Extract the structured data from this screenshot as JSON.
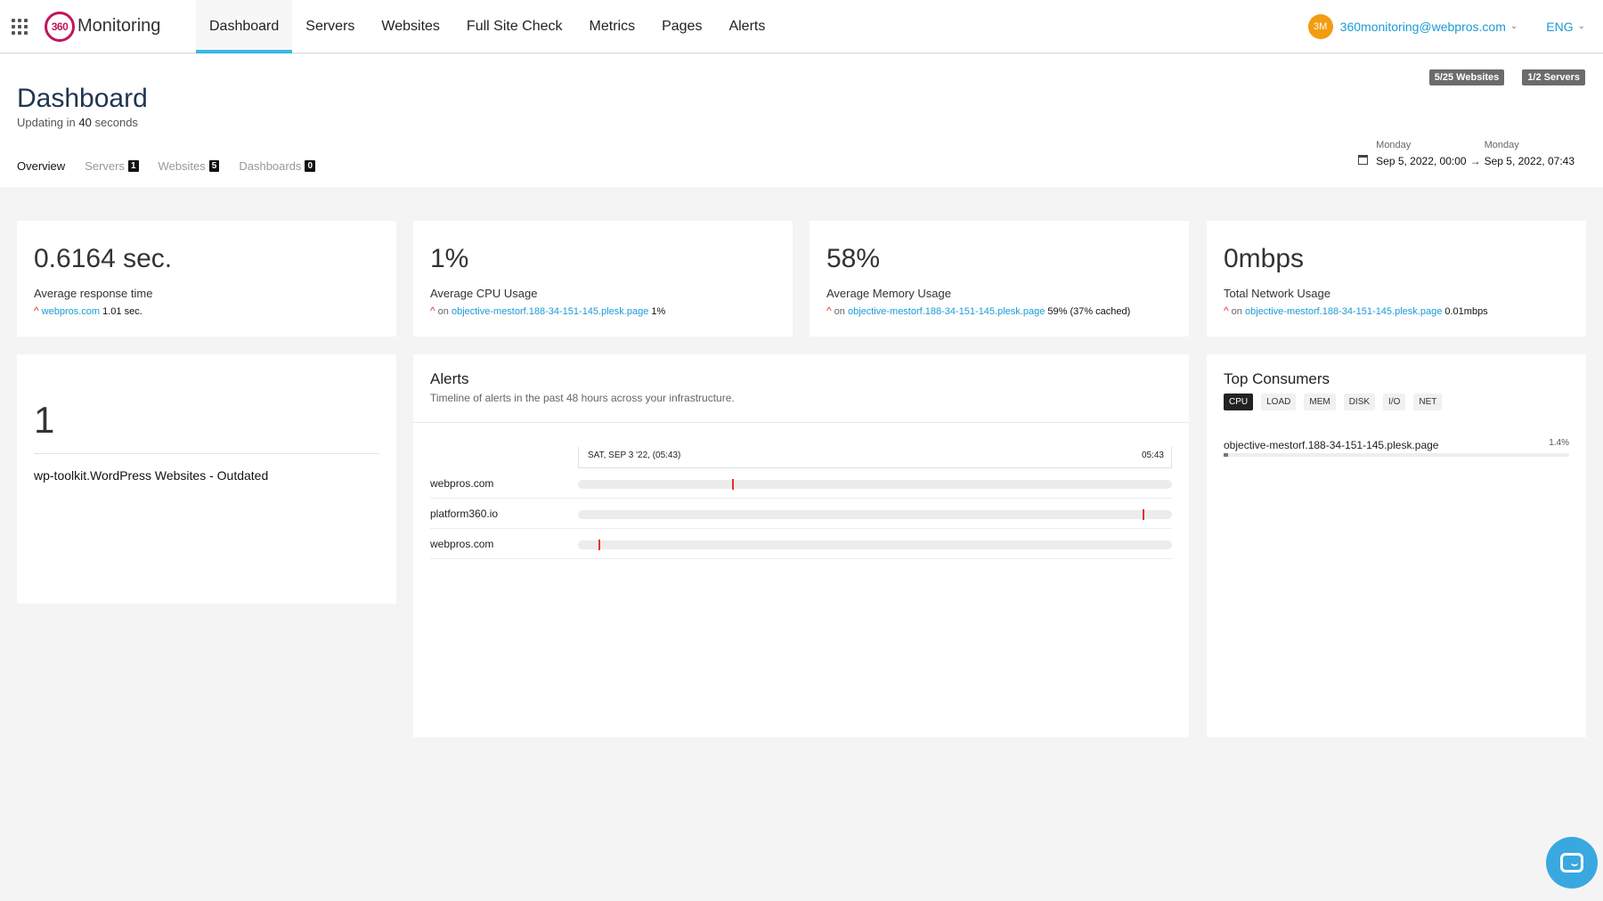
{
  "app": {
    "name": "Monitoring",
    "logo_text": "360"
  },
  "nav": [
    {
      "label": "Dashboard"
    },
    {
      "label": "Servers"
    },
    {
      "label": "Websites"
    },
    {
      "label": "Full Site Check"
    },
    {
      "label": "Metrics"
    },
    {
      "label": "Pages"
    },
    {
      "label": "Alerts"
    }
  ],
  "user": {
    "initials": "3M",
    "email": "360monitoring@webpros.com",
    "lang": "ENG"
  },
  "header": {
    "title": "Dashboard",
    "updating_prefix": "Updating in",
    "updating_value": "40",
    "updating_suffix": "seconds",
    "badges": [
      "5/25 Websites",
      "1/2 Servers"
    ],
    "tabs": [
      {
        "label": "Overview"
      },
      {
        "label": "Servers",
        "count": "1"
      },
      {
        "label": "Websites",
        "count": "5"
      },
      {
        "label": "Dashboards",
        "count": "0"
      }
    ],
    "range": {
      "from_day": "Monday",
      "from": "Sep 5, 2022, 00:00",
      "to_day": "Monday",
      "to": "Sep 5, 2022, 07:43"
    }
  },
  "stats": [
    {
      "value": "0.6164 sec.",
      "label": "Average response time",
      "on": "",
      "link": "webpros.com",
      "detail": "1.01 sec."
    },
    {
      "value": "1%",
      "label": "Average CPU Usage",
      "on": "on",
      "link": "objective-mestorf.188-34-151-145.plesk.page",
      "detail": "1%"
    },
    {
      "value": "58%",
      "label": "Average Memory Usage",
      "on": "on",
      "link": "objective-mestorf.188-34-151-145.plesk.page",
      "detail": "59% (37% cached)"
    },
    {
      "value": "0mbps",
      "label": "Total Network Usage",
      "on": "on",
      "link": "objective-mestorf.188-34-151-145.plesk.page",
      "detail": "0.01mbps"
    }
  ],
  "count_card": {
    "value": "1",
    "name": "wp-toolkit.WordPress Websites - Outdated"
  },
  "alerts": {
    "title": "Alerts",
    "subtitle": "Timeline of alerts in the past 48 hours across your infrastructure.",
    "start_label": "SAT, SEP 3 '22, (05:43)",
    "end_label": "05:43",
    "rows": [
      {
        "host": "webpros.com",
        "marks": [
          0.26
        ]
      },
      {
        "host": "platform360.io",
        "marks": [
          0.95
        ]
      },
      {
        "host": "webpros.com",
        "marks": [
          0.035
        ]
      }
    ]
  },
  "consumers": {
    "title": "Top Consumers",
    "tabs": [
      "CPU",
      "LOAD",
      "MEM",
      "DISK",
      "I/O",
      "NET"
    ],
    "active_tab": "CPU",
    "items": [
      {
        "name": "objective-mestorf.188-34-151-145.plesk.page",
        "value": "1.4%",
        "fraction": 0.014
      }
    ]
  },
  "colors": {
    "accent": "#3ab6e8",
    "link": "#1a9bd7",
    "alert": "#e0342c",
    "brand": "#c0155b",
    "avatar": "#f39c12"
  },
  "icons": {
    "apps": "apps-grid-icon",
    "calendar": "calendar-icon",
    "chat": "chat-icon",
    "trend": "arrow-up-icon"
  }
}
